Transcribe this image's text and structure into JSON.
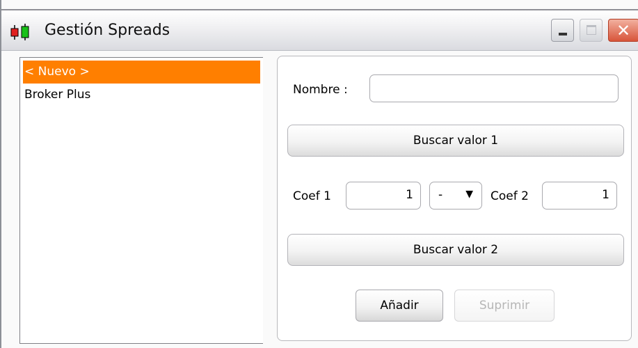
{
  "window": {
    "title": "Gestión Spreads"
  },
  "list": {
    "items": [
      "< Nuevo >",
      "Broker Plus"
    ],
    "selected_index": 0
  },
  "form": {
    "nombre_label": "Nombre :",
    "nombre_value": "",
    "buscar1_label": "Buscar valor 1",
    "coef1_label": "Coef 1",
    "coef1_value": "1",
    "operator_value": "-",
    "coef2_label": "Coef 2",
    "coef2_value": "1",
    "buscar2_label": "Buscar valor 2",
    "anadir_label": "Añadir",
    "suprimir_label": "Suprimir"
  },
  "colors": {
    "selection": "#ff7f00",
    "close_button": "#d8553a"
  }
}
